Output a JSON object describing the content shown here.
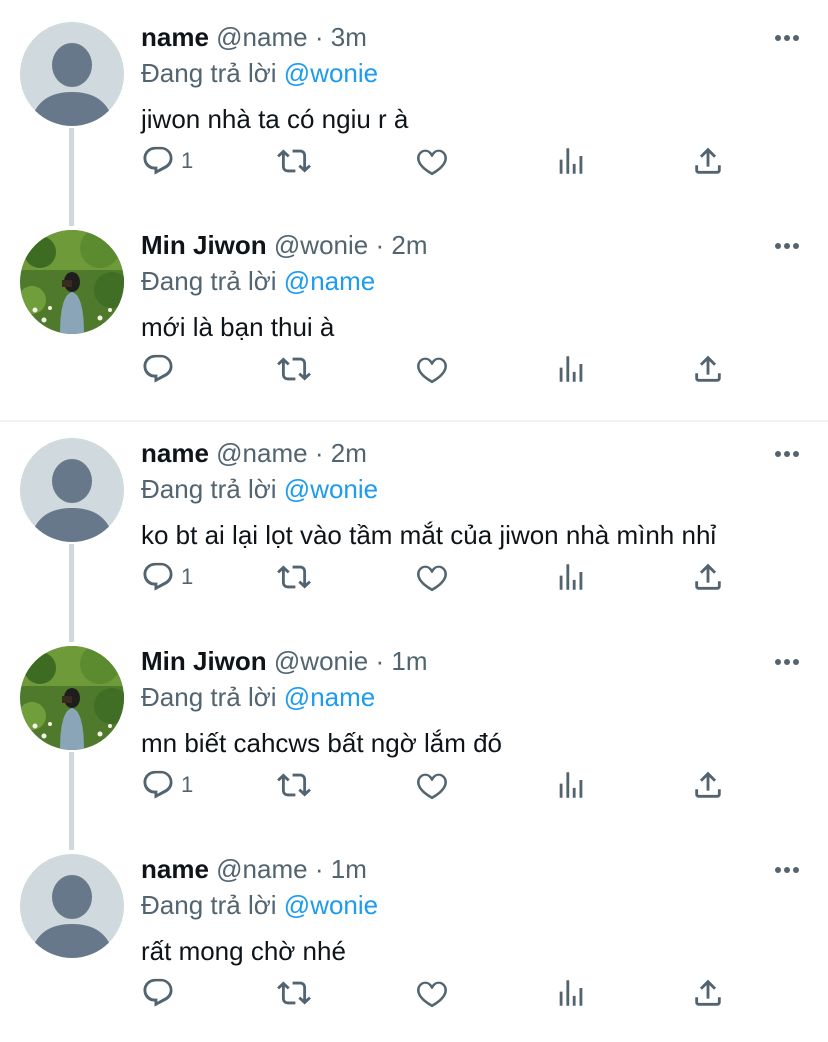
{
  "thread": {
    "tweets": [
      {
        "display_name": "name",
        "handle": "@name",
        "separator": "·",
        "time": "3m",
        "reply_prefix": "Đang trả lời",
        "reply_to": "@wonie",
        "text": "jiwon nhà ta có ngiu r à",
        "reply_count": "1",
        "avatar": "default-avatar"
      },
      {
        "display_name": "Min Jiwon",
        "handle": "@wonie",
        "separator": "·",
        "time": "2m",
        "reply_prefix": "Đang trả lời",
        "reply_to": "@name",
        "text": "mới là bạn thui à",
        "reply_count": "",
        "avatar": "photo-avatar"
      },
      {
        "display_name": "name",
        "handle": "@name",
        "separator": "·",
        "time": "2m",
        "reply_prefix": "Đang trả lời",
        "reply_to": "@wonie",
        "text": "ko bt ai lại lọt vào tầm mắt của jiwon nhà mình nhỉ",
        "reply_count": "1",
        "avatar": "default-avatar"
      },
      {
        "display_name": "Min Jiwon",
        "handle": "@wonie",
        "separator": "·",
        "time": "1m",
        "reply_prefix": "Đang trả lời",
        "reply_to": "@name",
        "text": "mn biết cahcws bất ngờ lắm đó",
        "reply_count": "1",
        "avatar": "photo-avatar"
      },
      {
        "display_name": "name",
        "handle": "@name",
        "separator": "·",
        "time": "1m",
        "reply_prefix": "Đang trả lời",
        "reply_to": "@wonie",
        "text": "rất mong chờ nhé",
        "reply_count": "",
        "avatar": "default-avatar"
      }
    ]
  },
  "icons": {
    "reply": "reply-icon",
    "retweet": "retweet-icon",
    "like": "like-icon",
    "views": "views-icon",
    "share": "share-icon",
    "more": "more-icon"
  },
  "colors": {
    "mention": "#1d9bf0",
    "secondary_text": "#536471",
    "primary_text": "#0f1419",
    "thread_line": "#cfd9de",
    "default_avatar_bg": "#cfd9de",
    "default_avatar_fg": "#66788a"
  }
}
